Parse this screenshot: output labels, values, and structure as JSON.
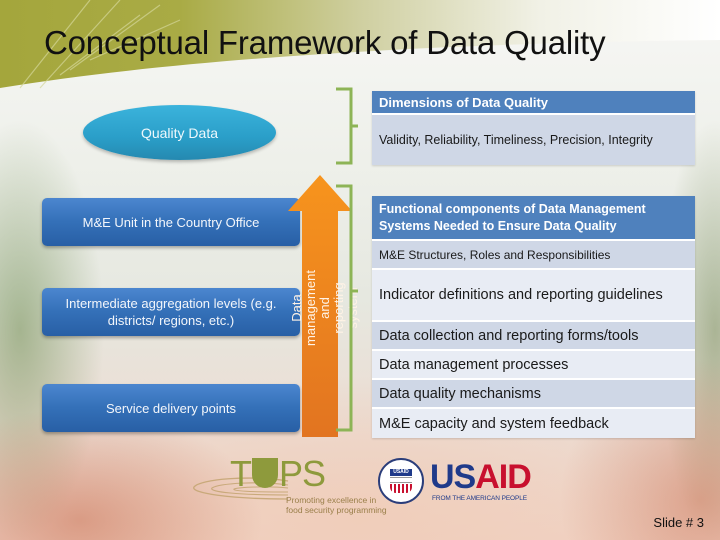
{
  "slide": {
    "title": "Conceptual Framework of Data Quality",
    "slide_number": "Slide # 3"
  },
  "colors": {
    "header_olive": "#9aa23c",
    "ellipse_blue": "#2a9ec8",
    "level_box_blue": "#3470b8",
    "arrow_orange": "#f08a24",
    "bracket_green": "#8db456",
    "table_header_blue": "#4f81bd",
    "table_row_dark": "#cfd7e6",
    "table_row_light": "#e8ecf4"
  },
  "quality_data": {
    "label": "Quality Data"
  },
  "levels": [
    {
      "label": "M&E Unit in the Country Office"
    },
    {
      "label": "Intermediate aggregation levels (e.g. districts/ regions, etc.)"
    },
    {
      "label": "Service delivery points"
    }
  ],
  "arrow": {
    "label": "Data management and reporting system",
    "direction": "up"
  },
  "dimensions_table": {
    "header": "Dimensions of Data Quality",
    "rows": [
      "Validity, Reliability, Timeliness, Precision, Integrity"
    ]
  },
  "functional_table": {
    "header": "Functional components of Data Management Systems Needed to Ensure Data Quality",
    "rows": [
      "M&E Structures, Roles and Responsibilities",
      "Indicator definitions and reporting guidelines",
      "Data collection and reporting forms/tools",
      "Data management processes",
      "Data quality mechanisms",
      "M&E capacity and system feedback"
    ]
  },
  "logos": {
    "tops": {
      "name": "TOPS",
      "name_prefix": "T",
      "name_suffix": "PS",
      "tagline_line1": "Promoting excellence in",
      "tagline_line2": "food security programming"
    },
    "usaid": {
      "name_part1": "US",
      "name_part2": "AID",
      "tagline": "FROM THE AMERICAN PEOPLE",
      "seal_text": "USAID"
    }
  }
}
